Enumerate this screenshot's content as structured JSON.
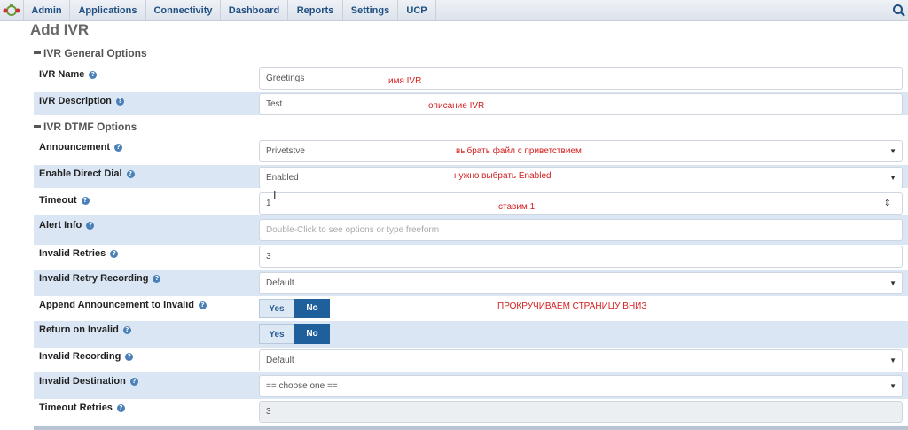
{
  "nav": {
    "items": [
      "Admin",
      "Applications",
      "Connectivity",
      "Dashboard",
      "Reports",
      "Settings",
      "UCP"
    ]
  },
  "page": {
    "title": "Add IVR"
  },
  "general": {
    "title": "IVR General Options",
    "name": {
      "label": "IVR Name",
      "value": "Greetings"
    },
    "description": {
      "label": "IVR Description",
      "value": "Test"
    }
  },
  "dtmf": {
    "title": "IVR DTMF Options",
    "announcement": {
      "label": "Announcement",
      "value": "Privetstve"
    },
    "direct_dial": {
      "label": "Enable Direct Dial",
      "value": "Enabled"
    },
    "timeout": {
      "label": "Timeout",
      "value": "1"
    },
    "alert_info": {
      "label": "Alert Info",
      "placeholder": "Double-Click to see options or type freeform"
    },
    "invalid_retries": {
      "label": "Invalid Retries",
      "value": "3"
    },
    "invalid_retry_recording": {
      "label": "Invalid Retry Recording",
      "value": "Default"
    },
    "append_announcement": {
      "label": "Append Announcement to Invalid",
      "yes": "Yes",
      "no": "No",
      "selected": "No"
    },
    "return_on_invalid": {
      "label": "Return on Invalid",
      "yes": "Yes",
      "no": "No",
      "selected": "No"
    },
    "invalid_recording": {
      "label": "Invalid Recording",
      "value": "Default"
    },
    "invalid_destination": {
      "label": "Invalid Destination",
      "value": "== choose one =="
    },
    "timeout_retries": {
      "label": "Timeout Retries",
      "value": "3"
    }
  },
  "annotations": {
    "name": "имя IVR",
    "description": "описание IVR",
    "announcement": "выбрать файл с приветствием",
    "direct_dial": "нужно выбрать Enabled",
    "timeout": "ставим 1",
    "scroll": "ПРОКРУЧИВАЕМ СТРАНИЦУ ВНИЗ"
  },
  "colors": {
    "nav_text": "#1f4e80",
    "row_shade": "#dbe6f5",
    "toggle_active": "#1f5f9b",
    "annotation": "#d42020",
    "help_icon": "#4a80b8"
  },
  "icons": [
    "freepbx-logo-icon",
    "search-icon",
    "help-icon",
    "chevron-down-icon",
    "spinner-arrows-icon",
    "text-cursor-icon"
  ]
}
